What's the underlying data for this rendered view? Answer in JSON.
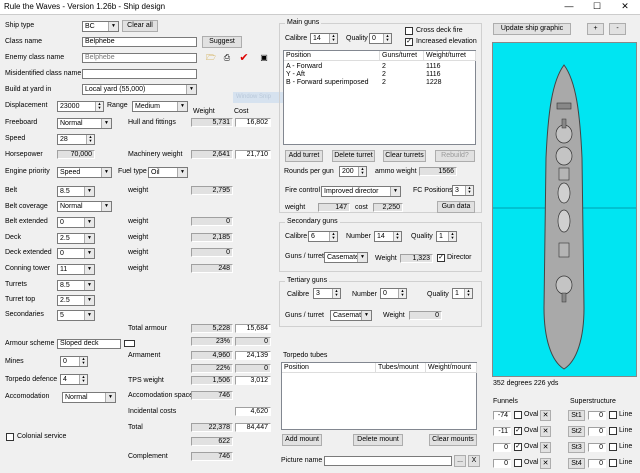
{
  "window": {
    "title": "Rule the Waves - Version 1.26b - Ship design",
    "minimize": "—",
    "maximize": "☐",
    "close": "✕"
  },
  "left": {
    "ship_type_label": "Ship type",
    "ship_type": "BC",
    "clear_all": "Clear all",
    "class_name_label": "Class name",
    "class_name": "Belphebe",
    "suggest": "Suggest",
    "enemy_class_label": "Enemy class name",
    "enemy_class": "Belphebe",
    "misidentified_label": "Misidentified class name",
    "misidentified": "",
    "build_label": "Build at yard in",
    "build": "Local yard (55,000)",
    "ghost_text": "Window Snip",
    "displacement_label": "Displacement",
    "displacement": "23000",
    "range_label": "Range",
    "range": "Medium",
    "weight_hdr": "Weight",
    "cost_hdr": "Cost",
    "freeboard_label": "Freeboard",
    "freeboard": "Normal",
    "hull_label": "Hull and fittings",
    "hull_weight": "5,731",
    "hull_cost": "16,802",
    "speed_label": "Speed",
    "speed": "28",
    "horsepower_label": "Horsepower",
    "horsepower": "70,000",
    "machinery_label": "Machinery weight",
    "machinery_weight": "2,641",
    "machinery_cost": "21,710",
    "engine_label": "Engine priority",
    "engine": "Speed",
    "fuel_label": "Fuel type",
    "fuel": "Oil",
    "belt_label": "Belt",
    "belt": "8.5",
    "belt_weight_label": "weight",
    "belt_weight": "2,795",
    "belt_cov_label": "Belt coverage",
    "belt_cov": "Normal",
    "belt_ext_label": "Belt extended",
    "belt_ext": "0",
    "belt_ext_weight_label": "weight",
    "belt_ext_weight": "0",
    "deck_label": "Deck",
    "deck": "2.5",
    "deck_weight_label": "weight",
    "deck_weight": "2,185",
    "deck_ext_label": "Deck extended",
    "deck_ext": "0",
    "deck_ext_weight_label": "weight",
    "deck_ext_weight": "0",
    "conning_label": "Conning tower",
    "conning": "11",
    "conning_weight_label": "weight",
    "conning_weight": "248",
    "turrets_label": "Turrets",
    "turrets": "8.5",
    "turret_top_label": "Turret top",
    "turret_top": "2.5",
    "secondaries_label": "Secondaries",
    "secondaries": "5",
    "total_armour_label": "Total armour",
    "total_armour_weight": "5,228",
    "total_armour_cost": "15,684",
    "armour_pct": "23%",
    "armour_pct_cost": "0",
    "armour_scheme_label": "Armour scheme",
    "armour_scheme": "Sloped deck",
    "armament_label": "Armament",
    "armament_weight": "4,960",
    "armament_cost": "24,139",
    "armament_pct": "22%",
    "armament_pct_cost": "0",
    "mines_label": "Mines",
    "mines": "0",
    "torpedo_def_label": "Torpedo defence",
    "torpedo_def": "4",
    "tps_label": "TPS weight",
    "tps_weight": "1,506",
    "tps_cost": "3,012",
    "accom_label": "Accomodation",
    "accom": "Normal",
    "accom_space_label": "Accomodation space",
    "accom_space": "746",
    "incidental_label": "Incidental costs",
    "incidental": "4,620",
    "total_label": "Total",
    "total_weight": "22,378",
    "total_cost": "84,447",
    "colonial_label": "Colonial service",
    "extra_value": "622",
    "complement_label": "Complement",
    "complement": "746"
  },
  "main_guns": {
    "title": "Main guns",
    "calibre_label": "Calibre",
    "calibre": "14",
    "quality_label": "Quality",
    "quality": "0",
    "cross_deck_label": "Cross deck fire",
    "cross_deck": false,
    "increased_elev_label": "Increased elevation",
    "increased_elev": true,
    "headers": [
      "Position",
      "Guns/turret",
      "Weight/turret"
    ],
    "rows": [
      {
        "position": "A - Forward",
        "guns": "2",
        "weight": "1116"
      },
      {
        "position": "Y - Aft",
        "guns": "2",
        "weight": "1116"
      },
      {
        "position": "B - Forward superimposed",
        "guns": "2",
        "weight": "1228"
      }
    ],
    "add_turret": "Add turret",
    "delete_turret": "Delete turret",
    "clear_turrets": "Clear turrets",
    "rebuild": "Rebuild?",
    "rounds_label": "Rounds per gun",
    "rounds": "200",
    "ammo_label": "ammo weight",
    "ammo_weight": "1566",
    "fire_control_label": "Fire control",
    "fire_control": "Improved director",
    "fc_positions_label": "FC Positions",
    "fc_positions": "3",
    "fc_weight_label": "weight",
    "fc_weight": "147",
    "fc_cost_label": "cost",
    "fc_cost": "2,250",
    "gun_data": "Gun data"
  },
  "secondary": {
    "title": "Secondary guns",
    "calibre_label": "Calibre",
    "calibre": "6",
    "number_label": "Number",
    "number": "14",
    "quality_label": "Quality",
    "quality": "1",
    "guns_turret_label": "Guns / turret",
    "guns_turret": "Casemate",
    "weight_label": "Weight",
    "weight": "1,323",
    "director_label": "Director",
    "director": true
  },
  "tertiary": {
    "title": "Tertiary guns",
    "calibre_label": "Calibre",
    "calibre": "3",
    "number_label": "Number",
    "number": "0",
    "quality_label": "Quality",
    "quality": "1",
    "guns_turret_label": "Guns / turret",
    "guns_turret": "Casemate",
    "weight_label": "Weight",
    "weight": "0"
  },
  "torpedo": {
    "title": "Torpedo tubes",
    "headers": [
      "Position",
      "Tubes/mount",
      "Weight/mount"
    ],
    "add_mount": "Add mount",
    "delete_mount": "Delete mount",
    "clear_mounts": "Clear mounts",
    "picture_label": "Picture name",
    "picture": "",
    "browse": "...",
    "browse2": "X"
  },
  "graphic": {
    "update": "Update ship graphic",
    "plus": "+",
    "minus": "-",
    "bearing": "352 degrees 226 yds",
    "funnels_label": "Funnels",
    "superstructure_label": "Superstructure",
    "oval_label": "Oval",
    "line_label": "Line",
    "funnel_rows": [
      {
        "pos": "-74",
        "oval": false,
        "st": "St1",
        "sup": "0",
        "line": false
      },
      {
        "pos": "-11",
        "oval": true,
        "st": "St2",
        "sup": "0",
        "line": false
      },
      {
        "pos": "0",
        "oval": true,
        "st": "St3",
        "sup": "0",
        "line": false
      },
      {
        "pos": "0",
        "oval": false,
        "st": "St4",
        "sup": "0",
        "line": false
      }
    ]
  }
}
